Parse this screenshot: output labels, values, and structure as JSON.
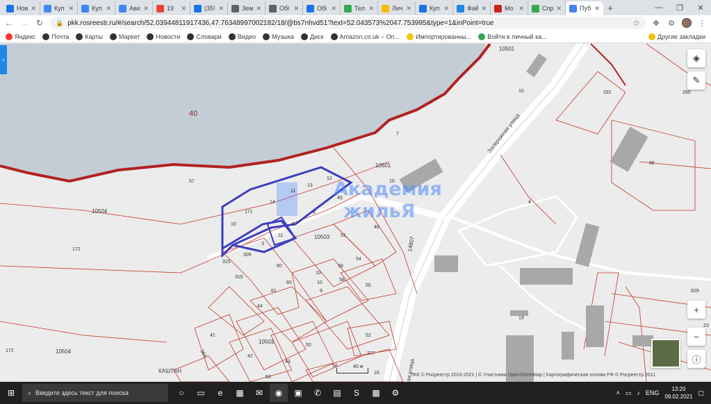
{
  "browser": {
    "tabs": [
      {
        "label": "Нов",
        "color": "#1a73e8"
      },
      {
        "label": "Куп",
        "color": "#4285f4"
      },
      {
        "label": "Куп",
        "color": "#4285f4"
      },
      {
        "label": "Ави",
        "color": "#4285f4"
      },
      {
        "label": "19",
        "color": "#ea4335"
      },
      {
        "label": "(35!",
        "color": "#1a73e8"
      },
      {
        "label": "Зем",
        "color": "#5f6368"
      },
      {
        "label": "Обі",
        "color": "#5f6368"
      },
      {
        "label": "Обі",
        "color": "#1a73e8"
      },
      {
        "label": "Тел",
        "color": "#34a853"
      },
      {
        "label": "Лич",
        "color": "#fbbc04"
      },
      {
        "label": "Куп",
        "color": "#1a73e8"
      },
      {
        "label": "Фай",
        "color": "#1e88e5"
      },
      {
        "label": "Мо",
        "color": "#c5221f"
      },
      {
        "label": "Спр",
        "color": "#34a853"
      },
      {
        "label": "Пуб",
        "color": "#4285f4",
        "active": true
      }
    ],
    "url": "pkk.rosreestr.ru/#/search/52.03944811917436,47.76348997002182/18/@bs7nhvd51?text=52.043573%2047.753995&type=1&inPoint=true",
    "bookmarks": [
      {
        "label": "Яндекс",
        "color": "#ff3333"
      },
      {
        "label": "Почта",
        "color": "#333333"
      },
      {
        "label": "Карты",
        "color": "#333333"
      },
      {
        "label": "Маркет",
        "color": "#333333"
      },
      {
        "label": "Новости",
        "color": "#333333"
      },
      {
        "label": "Словари",
        "color": "#333333"
      },
      {
        "label": "Видео",
        "color": "#333333"
      },
      {
        "label": "Музыка",
        "color": "#333333"
      },
      {
        "label": "Диск",
        "color": "#333333"
      },
      {
        "label": "Amazon.co.uk – On...",
        "color": "#333333"
      },
      {
        "label": "Импортированны...",
        "color": "#f4c20d"
      },
      {
        "label": "Войти в личный ка...",
        "color": "#34a853"
      }
    ],
    "bookmarks_other": "Другие закладки"
  },
  "map": {
    "water_label": "40",
    "parcels": [
      "10501",
      "10501",
      "10",
      "291",
      "290",
      "7",
      "57",
      "10504",
      "172",
      "10",
      "171",
      "14",
      "11",
      "13",
      "12",
      "45",
      "8",
      "2",
      "46",
      "10503",
      "3",
      "11",
      "51",
      "54",
      "315",
      "309",
      "60",
      "10",
      "58",
      "315",
      "61",
      "60",
      "10",
      "58",
      "9",
      "55",
      "44",
      "41",
      "364",
      "10503",
      "52",
      "50",
      "42",
      "377",
      "43",
      "56",
      "16",
      "63",
      "66",
      "4",
      "19",
      "14807",
      "23",
      "629",
      "172",
      "10504",
      "10"
    ],
    "streets": [
      "Заовражная улица",
      "КАШТАН",
      "ая улица"
    ],
    "watermark_line1": "Академия",
    "watermark_line2": "жильЯ",
    "scale_label": "40 м",
    "attribution": "ПКК © Росреестр 2010-2021 | © Участники OpenStreetMap | Картографическая основа РФ © Росреестр 2011",
    "zoom_in": "+",
    "zoom_out": "−"
  },
  "taskbar": {
    "search_placeholder": "Введите здесь текст для поиска",
    "lang": "ENG",
    "time": "13:20",
    "date": "09.02.2021"
  }
}
